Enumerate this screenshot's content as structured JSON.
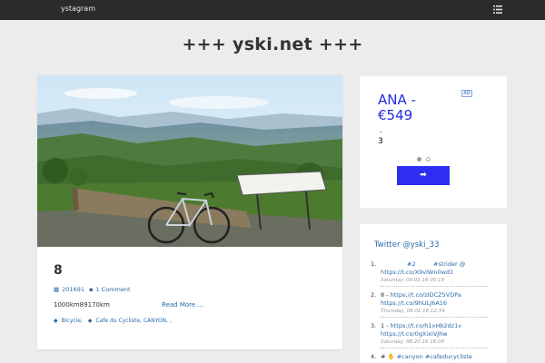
{
  "topbar": {
    "nav_link": "ystagram",
    "menu_icon": "list-menu-icon"
  },
  "site": {
    "title": "+++ yski.net +++"
  },
  "post": {
    "image_icon": "mountain-landscape-bicycle-photo",
    "title": "8",
    "date": "201691",
    "comments": "1 Comment",
    "excerpt": "1000km89170km",
    "read_more": "Read More ...",
    "tags": [
      "Bicycle,",
      "Cafe du Cycliste, CANYON, ,"
    ]
  },
  "ad": {
    "title": "ANA - €549",
    "badge": "AD",
    "dash": "-",
    "number": "3",
    "button_label": "➡"
  },
  "twitter": {
    "title": "Twitter @yski_33",
    "tweets": [
      {
        "num": "1.",
        "line1_plain": "#2",
        "line1_link": "#strider @",
        "line2": "https://t.co/X9vlWn0wd1",
        "time": "Saturday, 09.03.16 05:18"
      },
      {
        "num": "2.",
        "line1_plain": "8 -",
        "line1_link": "https://t.co/zIDCZ5VDPa",
        "line2": "https://t.co/9hULJ6A16",
        "time": "Thursday, 08.01.16 12:34"
      },
      {
        "num": "3.",
        "line1_plain": "1 -",
        "line1_link": "https://t.co/h1xHb2dz1v",
        "line2": "https://t.co/0gXixiVJhw",
        "time": "Saturday, 08.20.16 16:09"
      },
      {
        "num": "4.",
        "line1_plain": "#",
        "line1_link": "#canyon #cafeducycliste",
        "line2": "",
        "time": ""
      }
    ]
  },
  "colors": {
    "topbar_bg": "#2b2b2b",
    "page_bg": "#ececec",
    "link": "#2a6aa8",
    "ad_blue": "#2d2ef2"
  }
}
